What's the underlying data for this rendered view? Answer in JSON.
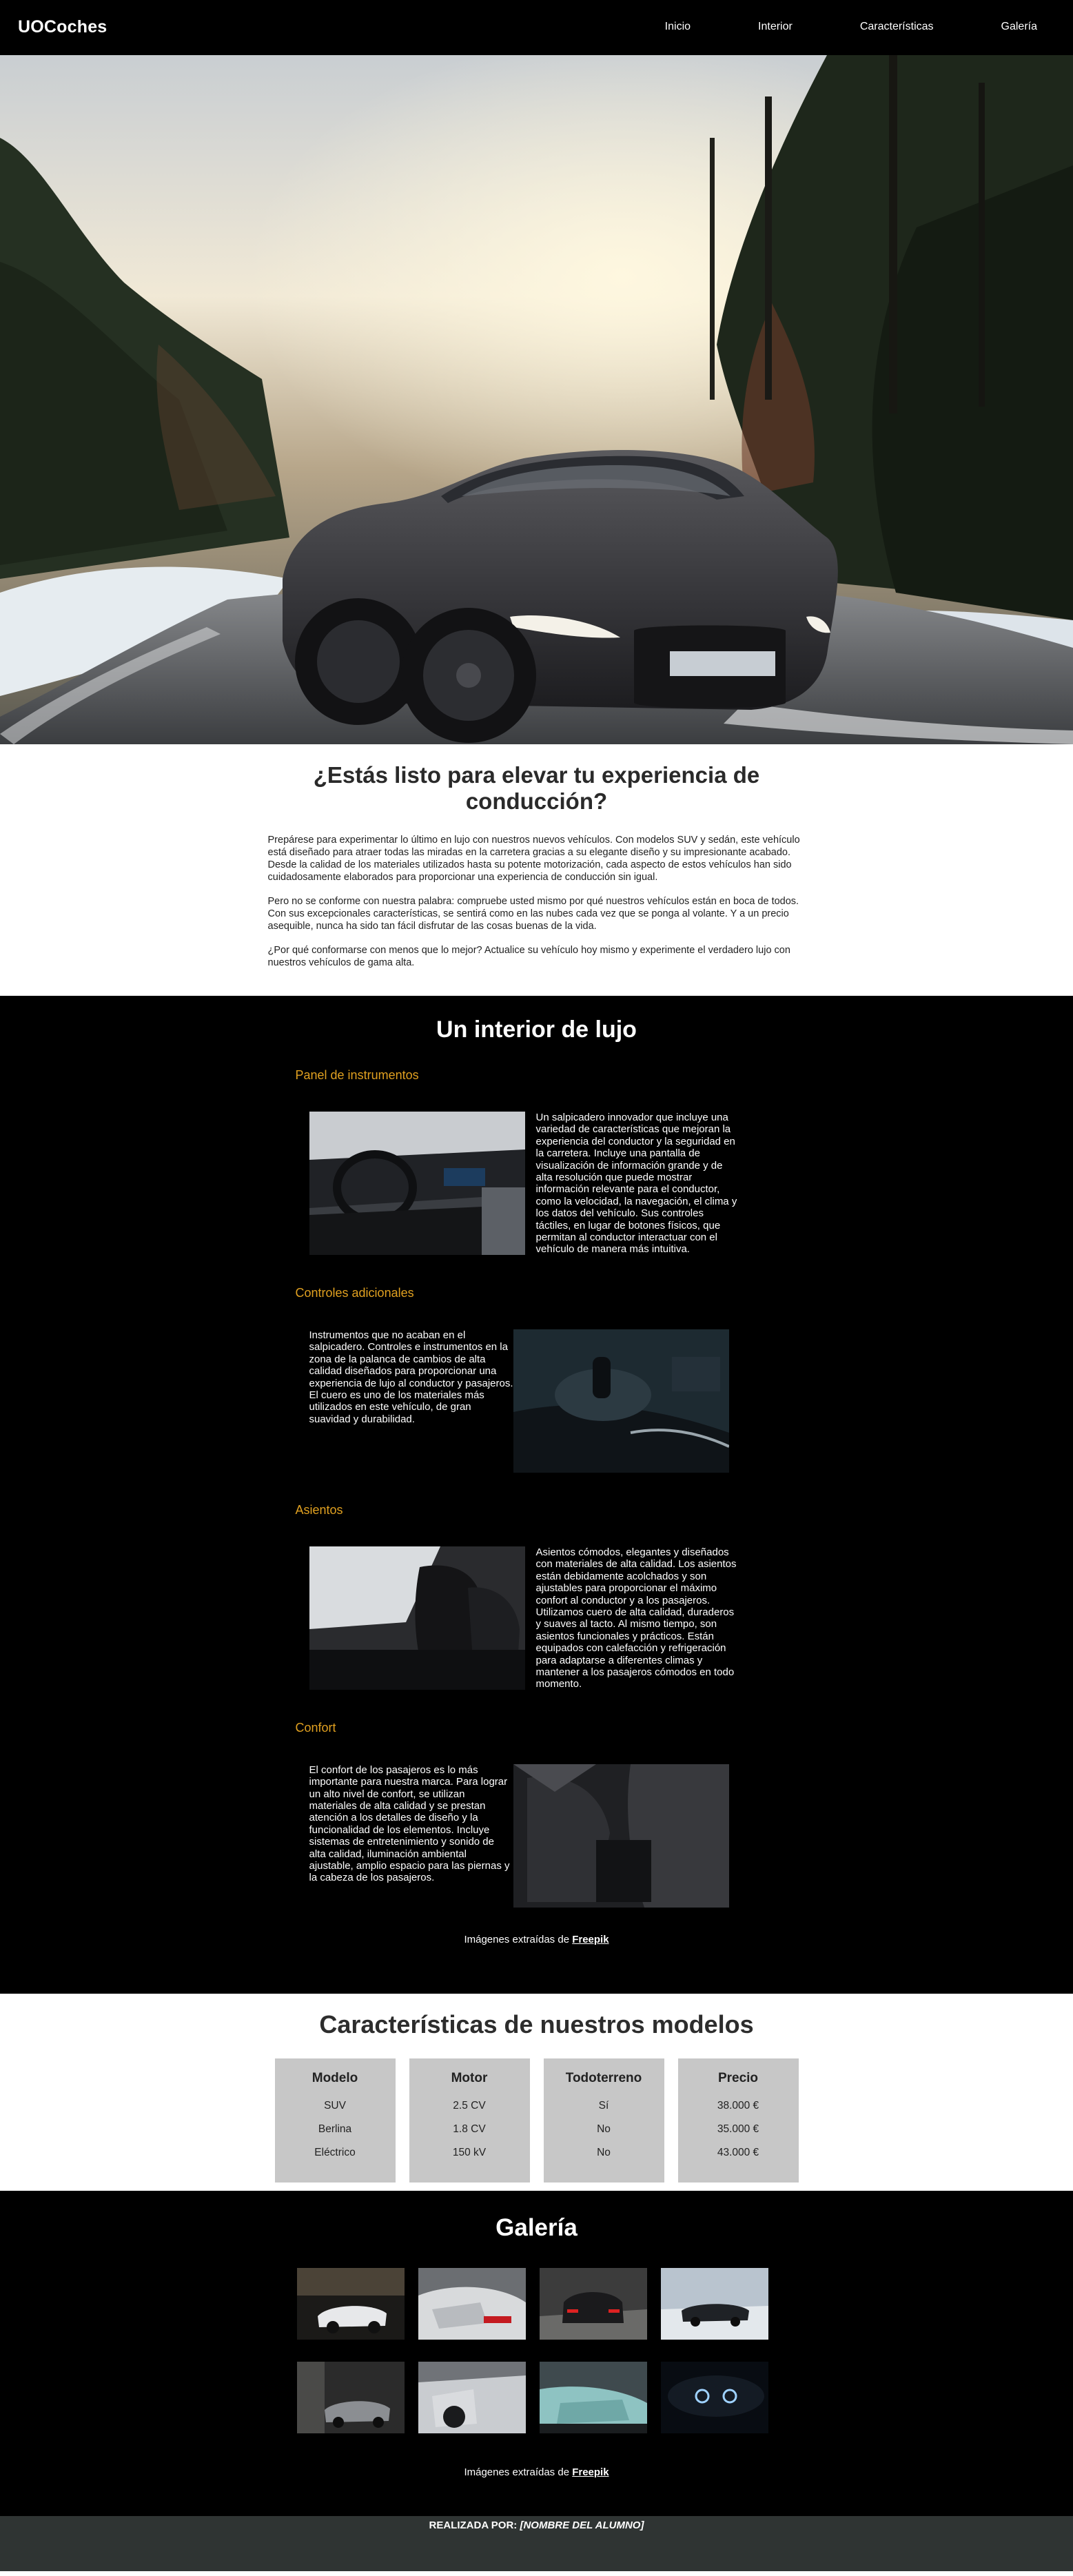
{
  "header": {
    "brand": "UOCoches",
    "nav": [
      "Inicio",
      "Interior",
      "Características",
      "Galería"
    ]
  },
  "intro": {
    "title": "¿Estás listo para elevar tu experiencia de conducción?",
    "paragraphs": [
      "Prepárese para experimentar lo último en lujo con nuestros nuevos vehículos. Con modelos SUV y sedán, este vehículo está diseñado para atraer todas las miradas en la carretera gracias a su elegante diseño y su impresionante acabado. Desde la calidad de los materiales utilizados hasta su potente motorización, cada aspecto de estos vehículos han sido cuidadosamente elaborados para proporcionar una experiencia de conducción sin igual.",
      "Pero no se conforme con nuestra palabra: compruebe usted mismo por qué nuestros vehículos están en boca de todos. Con sus excepcionales características, se sentirá como en las nubes cada vez que se ponga al volante. Y a un precio asequible, nunca ha sido tan fácil disfrutar de las cosas buenas de la vida.",
      "¿Por qué conformarse con menos que lo mejor? Actualice su vehículo hoy mismo y experimente el verdadero lujo con nuestros vehículos de gama alta."
    ]
  },
  "interior": {
    "title": "Un interior de lujo",
    "features": [
      {
        "title": "Panel de instrumentos",
        "text": "Un salpicadero innovador que incluye una variedad de características que mejoran la experiencia del conductor y la seguridad en la carretera. Incluye una pantalla de visualización de información grande y de alta resolución que puede mostrar información relevante para el conductor, como la velocidad, la navegación, el clima y los datos del vehículo. Sus controles táctiles, en lugar de botones físicos, que permitan al conductor interactuar con el vehículo de manera más intuitiva."
      },
      {
        "title": "Controles adicionales",
        "text": "Instrumentos que no acaban en el salpicadero. Controles e instrumentos en la zona de la palanca de cambios de alta calidad diseñados para proporcionar una experiencia de lujo al conductor y pasajeros. El cuero es uno de los materiales más utilizados en este vehículo, de gran suavidad y durabilidad."
      },
      {
        "title": "Asientos",
        "text": "Asientos cómodos, elegantes y diseñados con materiales de alta calidad. Los asientos están debidamente acolchados y son ajustables para proporcionar el máximo confort al conductor y a los pasajeros. Utilizamos cuero de alta calidad, duraderos y suaves al tacto. Al mismo tiempo, son asientos funcionales y prácticos. Están equipados con calefacción y refrigeración para adaptarse a diferentes climas y mantener a los pasajeros cómodos en todo momento."
      },
      {
        "title": "Confort",
        "text": "El confort de los pasajeros es lo más importante para nuestra marca. Para lograr un alto nivel de confort, se utilizan materiales de alta calidad y se prestan atención a los detalles de diseño y la funcionalidad de los elementos. Incluye sistemas de entretenimiento y sonido de alta calidad, iluminación ambiental ajustable, amplio espacio para las piernas y la cabeza de los pasajeros."
      }
    ],
    "credit_prefix": "Imágenes extraídas de ",
    "credit_link": "Freepik"
  },
  "models": {
    "title": "Características de nuestros modelos",
    "columns": [
      {
        "head": "Modelo",
        "cells": [
          "SUV",
          "Berlina",
          "Eléctrico"
        ]
      },
      {
        "head": "Motor",
        "cells": [
          "2.5 CV",
          "1.8 CV",
          "150 kV"
        ]
      },
      {
        "head": "Todoterreno",
        "cells": [
          "Sí",
          "No",
          "No"
        ]
      },
      {
        "head": "Precio",
        "cells": [
          "38.000 €",
          "35.000 €",
          "43.000 €"
        ]
      }
    ]
  },
  "gallery": {
    "title": "Galería",
    "credit_prefix": "Imágenes extraídas de ",
    "credit_link": "Freepik"
  },
  "footer": {
    "prefix": "REALIZADA POR: ",
    "name": "[NOMBRE DEL ALUMNO]"
  }
}
